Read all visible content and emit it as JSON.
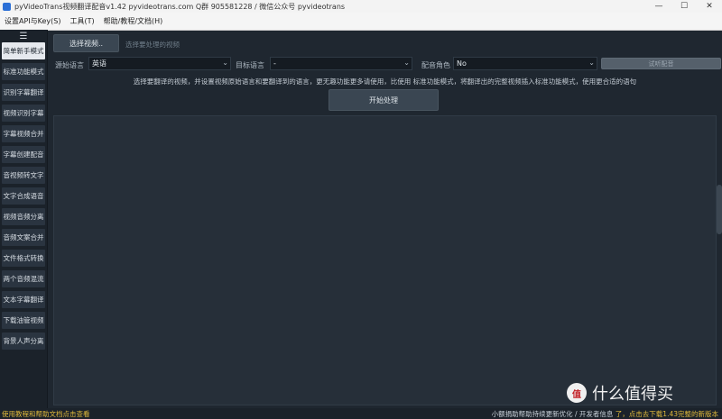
{
  "window": {
    "title": "pyVideoTrans视频翻译配音v1.42  pyvideotrans.com   Q群 905581228 / 微信公众号 pyvideotrans",
    "minimize": "—",
    "maximize": "☐",
    "close": "✕"
  },
  "menu": [
    "设置API与Key(S)",
    "工具(T)",
    "帮助/教程/文档(H)"
  ],
  "sidebar": {
    "toggle": "☰",
    "items": [
      {
        "label": "简单新手模式",
        "active": true
      },
      {
        "label": "标准功能模式",
        "active": false
      },
      {
        "label": "识别字幕翻译",
        "active": false
      },
      {
        "label": "视频识别字幕",
        "active": false
      },
      {
        "label": "字幕视频合并",
        "active": false
      },
      {
        "label": "字幕创建配音",
        "active": false
      },
      {
        "label": "音视频转文字",
        "active": false
      },
      {
        "label": "文字合成语音",
        "active": false
      },
      {
        "label": "视频音频分离",
        "active": false
      },
      {
        "label": "音频文案合并",
        "active": false
      },
      {
        "label": "文件格式转换",
        "active": false
      },
      {
        "label": "两个音频混流",
        "active": false
      },
      {
        "label": "文本字幕翻译",
        "active": false
      },
      {
        "label": "下载油管视频",
        "active": false
      },
      {
        "label": "背景人声分离",
        "active": false
      }
    ]
  },
  "main": {
    "select_video_label": "选择视频..",
    "select_hint": "选择要处理的视频",
    "source_lang_label": "源始语言",
    "source_lang_value": "英语",
    "target_lang_label": "目标语言",
    "target_lang_value": "-",
    "role_label": "配音角色",
    "role_value": "No",
    "test_label": "试听配音",
    "instruction": "选择要翻译的视频，并设置视频原始语言和要翻译到的语言，更无趣功能更多请使用，比使用 标准功能模式，将翻译出的完整视频插入标准功能模式，使用更合适的语句",
    "start_label": "开始处理"
  },
  "status": {
    "left": "使用教程和帮助文档点击查看",
    "right_text": "小额捐助帮助持续更新优化 / 开发者信息",
    "right_highlight": "了，点击去下载1.43完整的新版本"
  },
  "watermark": {
    "logo_text": "值",
    "text": "什么值得买"
  }
}
